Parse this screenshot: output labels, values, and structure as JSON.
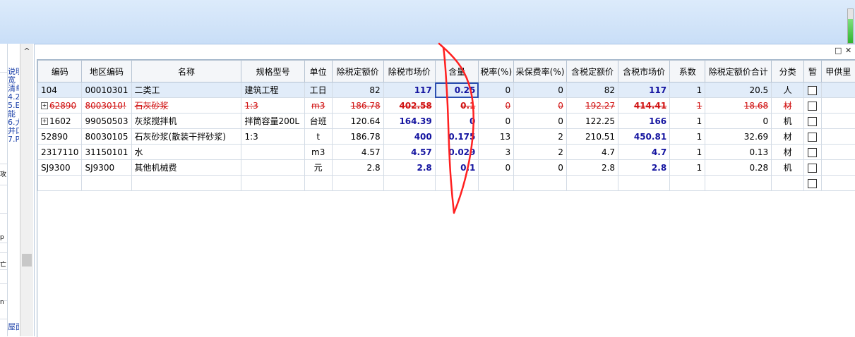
{
  "colors": {
    "accent_bold": "#1414a0",
    "strike_red": "#d11414",
    "annotation_red": "#ff2020",
    "header_band": "#c9def7"
  },
  "progress_fraction": 0.7,
  "left_panel": {
    "scroll_up": "^",
    "snippets": [
      "说明",
      "宽",
      "清单",
      "4.2",
      "5.E",
      "能",
      "6.大",
      "并口",
      "7.P"
    ],
    "side_marks": [
      "攻",
      "p",
      "亡",
      "n"
    ],
    "bottom_text": "屋面"
  },
  "window_buttons": {
    "restore": "□",
    "close": "✕"
  },
  "table": {
    "columns": [
      "编码",
      "地区编码",
      "名称",
      "规格型号",
      "单位",
      "除税定额价",
      "除税市场价",
      "含量",
      "税率(%)",
      "采保费率(%)",
      "含税定额价",
      "含税市场价",
      "系数",
      "除税定额价合计",
      "分类",
      "暂",
      "甲供里"
    ],
    "rows": [
      {
        "code": "104",
        "area": "00010301",
        "name": "二类工",
        "spec": "建筑工程",
        "unit": "工日",
        "p1": "82",
        "p2": "117",
        "qty": "0.25",
        "tax": "0",
        "fee": "0",
        "p3": "82",
        "p4": "117",
        "coef": "1",
        "total": "20.5",
        "cat": "人",
        "expand": ""
      },
      {
        "code": "62890",
        "area": "8003010!",
        "name": "石灰砂浆",
        "spec": "1:3",
        "unit": "m3",
        "p1": "186.78",
        "p2": "402.58",
        "qty": "0.1",
        "tax": "0",
        "fee": "0",
        "p3": "192.27",
        "p4": "414.41",
        "coef": "1",
        "total": "18.68",
        "cat": "材",
        "expand": "+"
      },
      {
        "code": "1602",
        "area": "99050503",
        "name": "灰浆搅拌机",
        "spec": "拌筒容量200L",
        "unit": "台班",
        "p1": "120.64",
        "p2": "164.39",
        "qty": "0",
        "tax": "0",
        "fee": "0",
        "p3": "122.25",
        "p4": "166",
        "coef": "1",
        "total": "0",
        "cat": "机",
        "expand": "+"
      },
      {
        "code": "52890",
        "area": "80030105",
        "name": "石灰砂浆(散装干拌砂浆)",
        "spec": "1:3",
        "unit": "t",
        "p1": "186.78",
        "p2": "400",
        "qty": "0.175",
        "tax": "13",
        "fee": "2",
        "p3": "210.51",
        "p4": "450.81",
        "coef": "1",
        "total": "32.69",
        "cat": "材",
        "expand": ""
      },
      {
        "code": "2317110",
        "area": "31150101",
        "name": "水",
        "spec": "",
        "unit": "m3",
        "p1": "4.57",
        "p2": "4.57",
        "qty": "0.029",
        "tax": "3",
        "fee": "2",
        "p3": "4.7",
        "p4": "4.7",
        "coef": "1",
        "total": "0.13",
        "cat": "材",
        "expand": ""
      },
      {
        "code": "SJ9300",
        "area": "SJ9300",
        "name": "其他机械费",
        "spec": "",
        "unit": "元",
        "p1": "2.8",
        "p2": "2.8",
        "qty": "0.1",
        "tax": "0",
        "fee": "0",
        "p3": "2.8",
        "p4": "2.8",
        "coef": "1",
        "total": "0.28",
        "cat": "机",
        "expand": ""
      }
    ]
  }
}
